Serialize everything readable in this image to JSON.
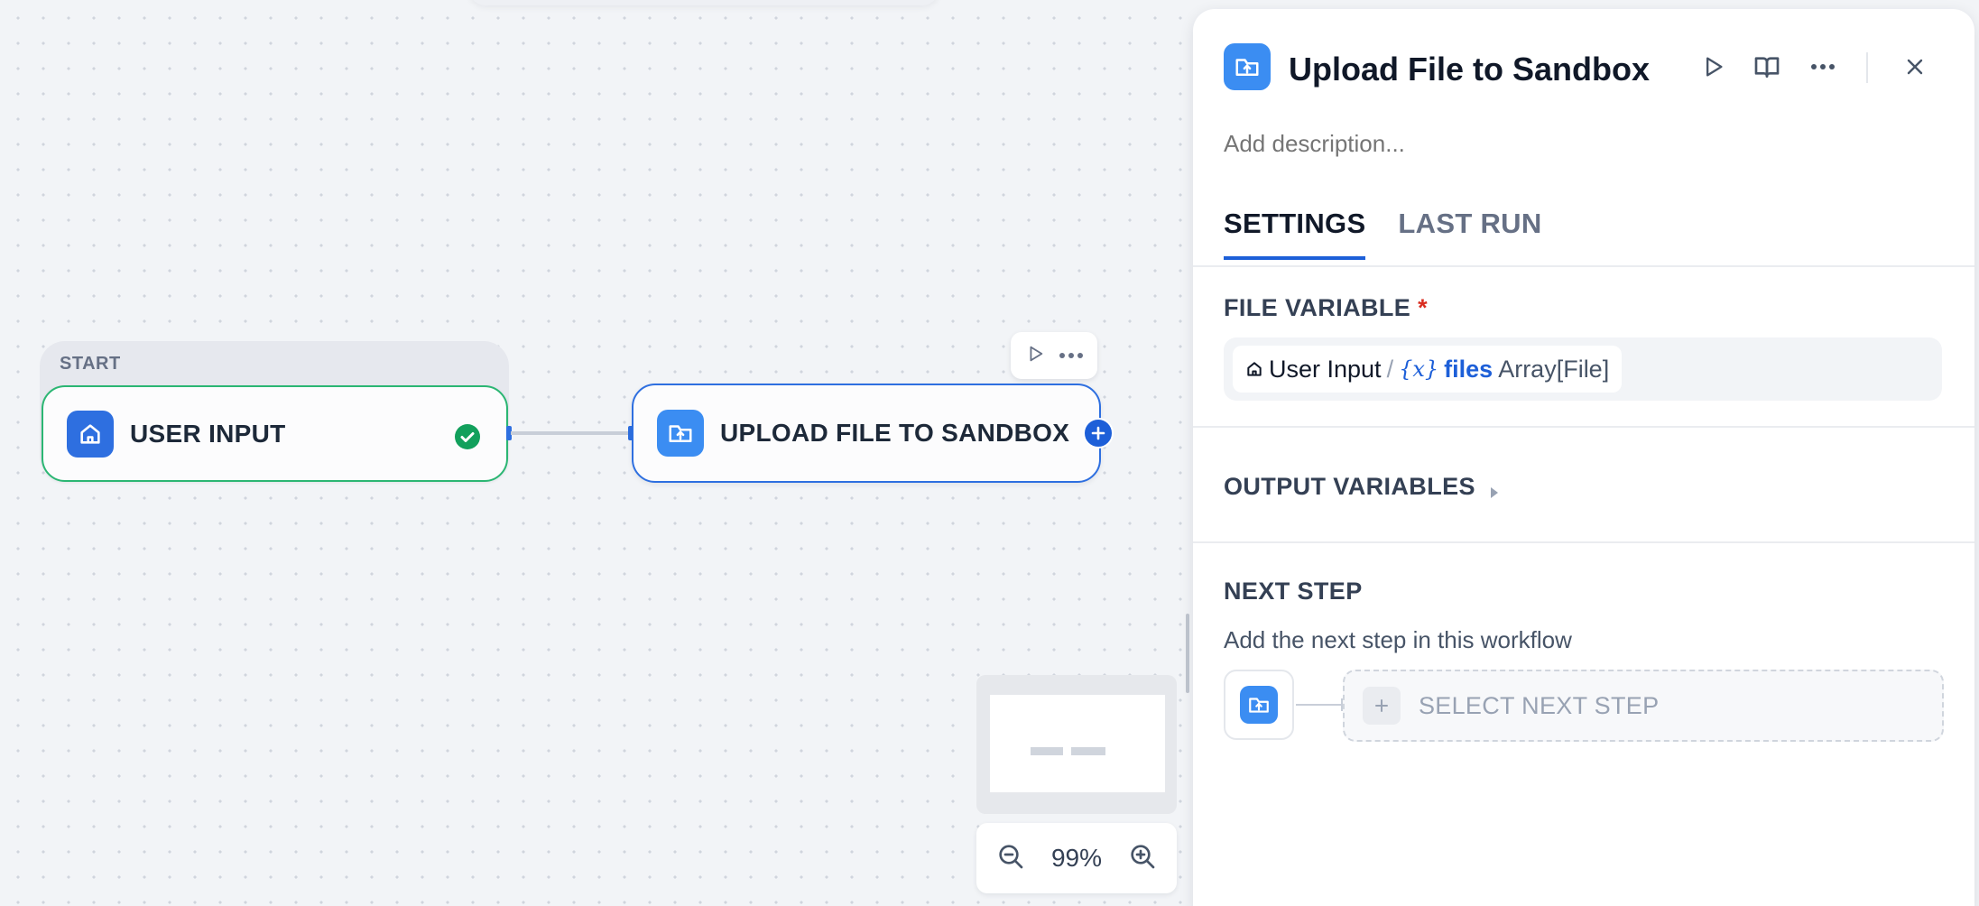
{
  "canvas": {
    "start_group": {
      "label": "START"
    },
    "nodes": [
      {
        "title": "USER INPUT",
        "icon": "home-icon",
        "status": "success-check-icon"
      },
      {
        "title": "UPLOAD FILE TO SANDBOX",
        "icon": "folder-upload-icon"
      }
    ],
    "zoom": {
      "value": "99%"
    }
  },
  "panel": {
    "title": "Upload File to Sandbox",
    "description_placeholder": "Add description...",
    "tabs": [
      {
        "label": "SETTINGS",
        "active": true
      },
      {
        "label": "LAST RUN",
        "active": false
      }
    ],
    "file_variable": {
      "label": "FILE VARIABLE",
      "required_mark": "*",
      "source_node": "User Input",
      "separator": "/",
      "var_symbol": "{x}",
      "var_name": "files",
      "var_type": "Array[File]"
    },
    "output_variables": {
      "label": "OUTPUT VARIABLES"
    },
    "next_step": {
      "label": "NEXT STEP",
      "description": "Add the next step in this workflow",
      "select_label": "SELECT NEXT STEP"
    }
  },
  "colors": {
    "accent": "#1d5fd8",
    "success": "#2bb673",
    "folder_icon_bg": "#3b8df2",
    "required": "#d92d20"
  }
}
